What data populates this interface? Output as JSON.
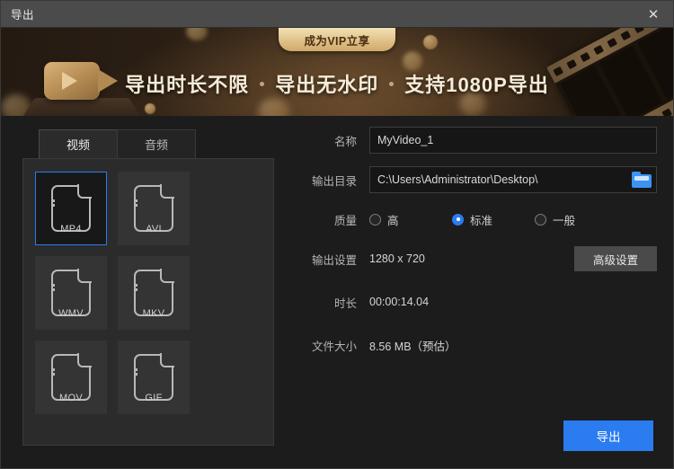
{
  "titlebar": {
    "title": "导出",
    "close_label": "✕"
  },
  "banner": {
    "vip_badge": "成为VIP立享",
    "features": [
      "导出时长不限",
      "导出无水印",
      "支持1080P导出"
    ],
    "gold": "#e0c189",
    "text_color": "#f6ecd8"
  },
  "left_panel": {
    "tabs": [
      {
        "label": "视频",
        "active": true
      },
      {
        "label": "音频",
        "active": false
      }
    ],
    "formats": [
      {
        "label": "MP4",
        "selected": true
      },
      {
        "label": "AVI",
        "selected": false
      },
      {
        "label": "WMV",
        "selected": false
      },
      {
        "label": "MKV",
        "selected": false
      },
      {
        "label": "MOV",
        "selected": false
      },
      {
        "label": "GIF",
        "selected": false
      }
    ],
    "selected_border": "#2a7cf0"
  },
  "right_panel": {
    "name": {
      "label": "名称",
      "value": "MyVideo_1",
      "placeholder": "MyVideo_1"
    },
    "output_dir": {
      "label": "输出目录",
      "value": "C:\\Users\\Administrator\\Desktop\\",
      "placeholder": "C:\\Users\\Administrator\\Desktop\\",
      "browse_icon": "folder-icon"
    },
    "quality": {
      "label": "质量",
      "options": [
        {
          "label": "高",
          "checked": false
        },
        {
          "label": "标准",
          "checked": true
        },
        {
          "label": "一般",
          "checked": false
        }
      ],
      "accent": "#2a7cf0"
    },
    "output_settings": {
      "label": "输出设置",
      "value": "1280 x 720",
      "advanced_label": "高级设置"
    },
    "duration": {
      "label": "时长",
      "value": "00:00:14.04"
    },
    "file_size": {
      "label": "文件大小",
      "value": "8.56 MB（预估）"
    }
  },
  "footer": {
    "export_label": "导出",
    "export_color": "#2a7cf0"
  }
}
